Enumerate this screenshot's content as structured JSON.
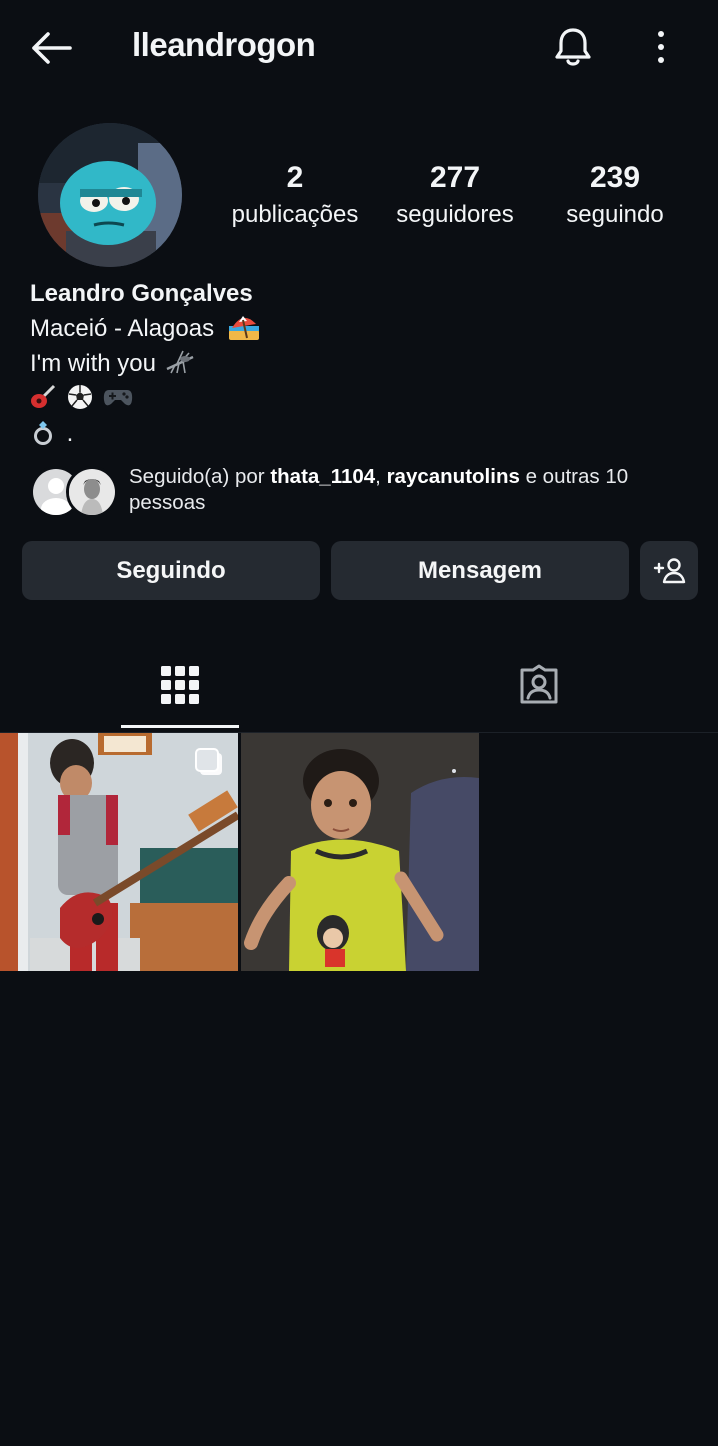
{
  "header": {
    "username": "lleandrogon",
    "icons": [
      "back-arrow-icon",
      "bell-icon",
      "more-vertical-icon"
    ]
  },
  "stats": [
    {
      "value": "2",
      "label": "publicações"
    },
    {
      "value": "277",
      "label": "seguidores"
    },
    {
      "value": "239",
      "label": "seguindo"
    }
  ],
  "bio": {
    "name": "Leandro Gonçalves",
    "location": "Maceió - Alagoas",
    "line2": "I'm with you",
    "line4_suffix": "."
  },
  "followed_by": {
    "prefix": "Seguido(a) por ",
    "user1": "thata_1104",
    "sep": ", ",
    "user2": "raycanutolins",
    "suffix": " e outras 10 pessoas"
  },
  "actions": {
    "following": "Seguindo",
    "message": "Mensagem"
  },
  "tabs": [
    {
      "icon": "grid-icon",
      "active": true
    },
    {
      "icon": "tagged-icon",
      "active": false
    }
  ],
  "posts": [
    {
      "desc": "boy-playing-red-bass-guitar",
      "multiple": true
    },
    {
      "desc": "child-in-yellow-shirt",
      "multiple": false
    }
  ],
  "colors": {
    "background": "#0b0e13",
    "button": "#252a31",
    "text": "#f3f5f7"
  }
}
